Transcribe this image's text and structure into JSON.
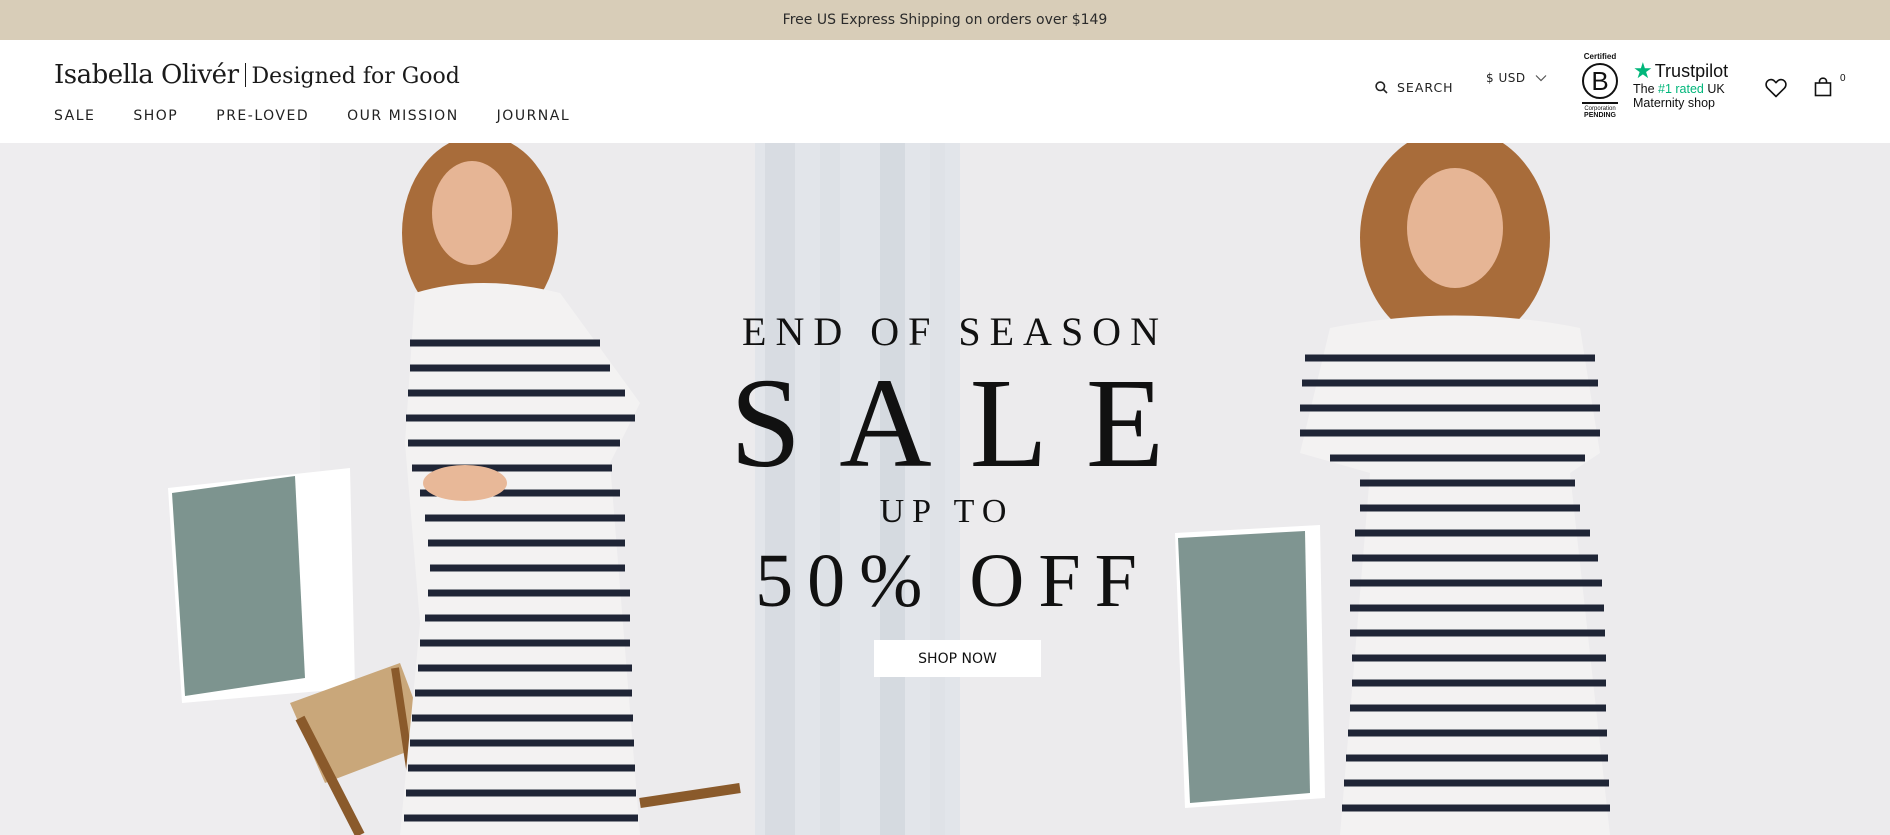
{
  "announcement": {
    "text": "Free US Express Shipping on orders over $149"
  },
  "logo": {
    "brand": "Isabella Olivér",
    "tagline": "Designed for Good"
  },
  "nav": {
    "items": [
      {
        "label": "SALE"
      },
      {
        "label": "SHOP"
      },
      {
        "label": "PRE-LOVED"
      },
      {
        "label": "OUR MISSION"
      },
      {
        "label": "JOURNAL"
      }
    ]
  },
  "header": {
    "search_label": "SEARCH",
    "currency": "$ USD",
    "cart_count": "0"
  },
  "bcorp": {
    "certified": "Certified",
    "letter": "B",
    "corporation": "Corporation",
    "pending": "PENDING"
  },
  "trustpilot": {
    "brand": "Trustpilot",
    "line1_prefix": "The ",
    "line1_highlight": "#1 rated",
    "line1_suffix": " UK",
    "line2": "Maternity shop"
  },
  "hero": {
    "eyebrow": "END OF SEASON",
    "headline": "SALE",
    "subline": "UP TO",
    "offer": "50% OFF",
    "cta": "SHOP NOW"
  },
  "colors": {
    "announcement_bg": "#d8cdb8",
    "trustpilot_green": "#00b67a",
    "hero_bg": "#ebeaec"
  },
  "icons": [
    "search-icon",
    "chevron-down-icon",
    "heart-icon",
    "shopping-bag-icon",
    "trustpilot-star-icon",
    "b-corp-logo"
  ]
}
